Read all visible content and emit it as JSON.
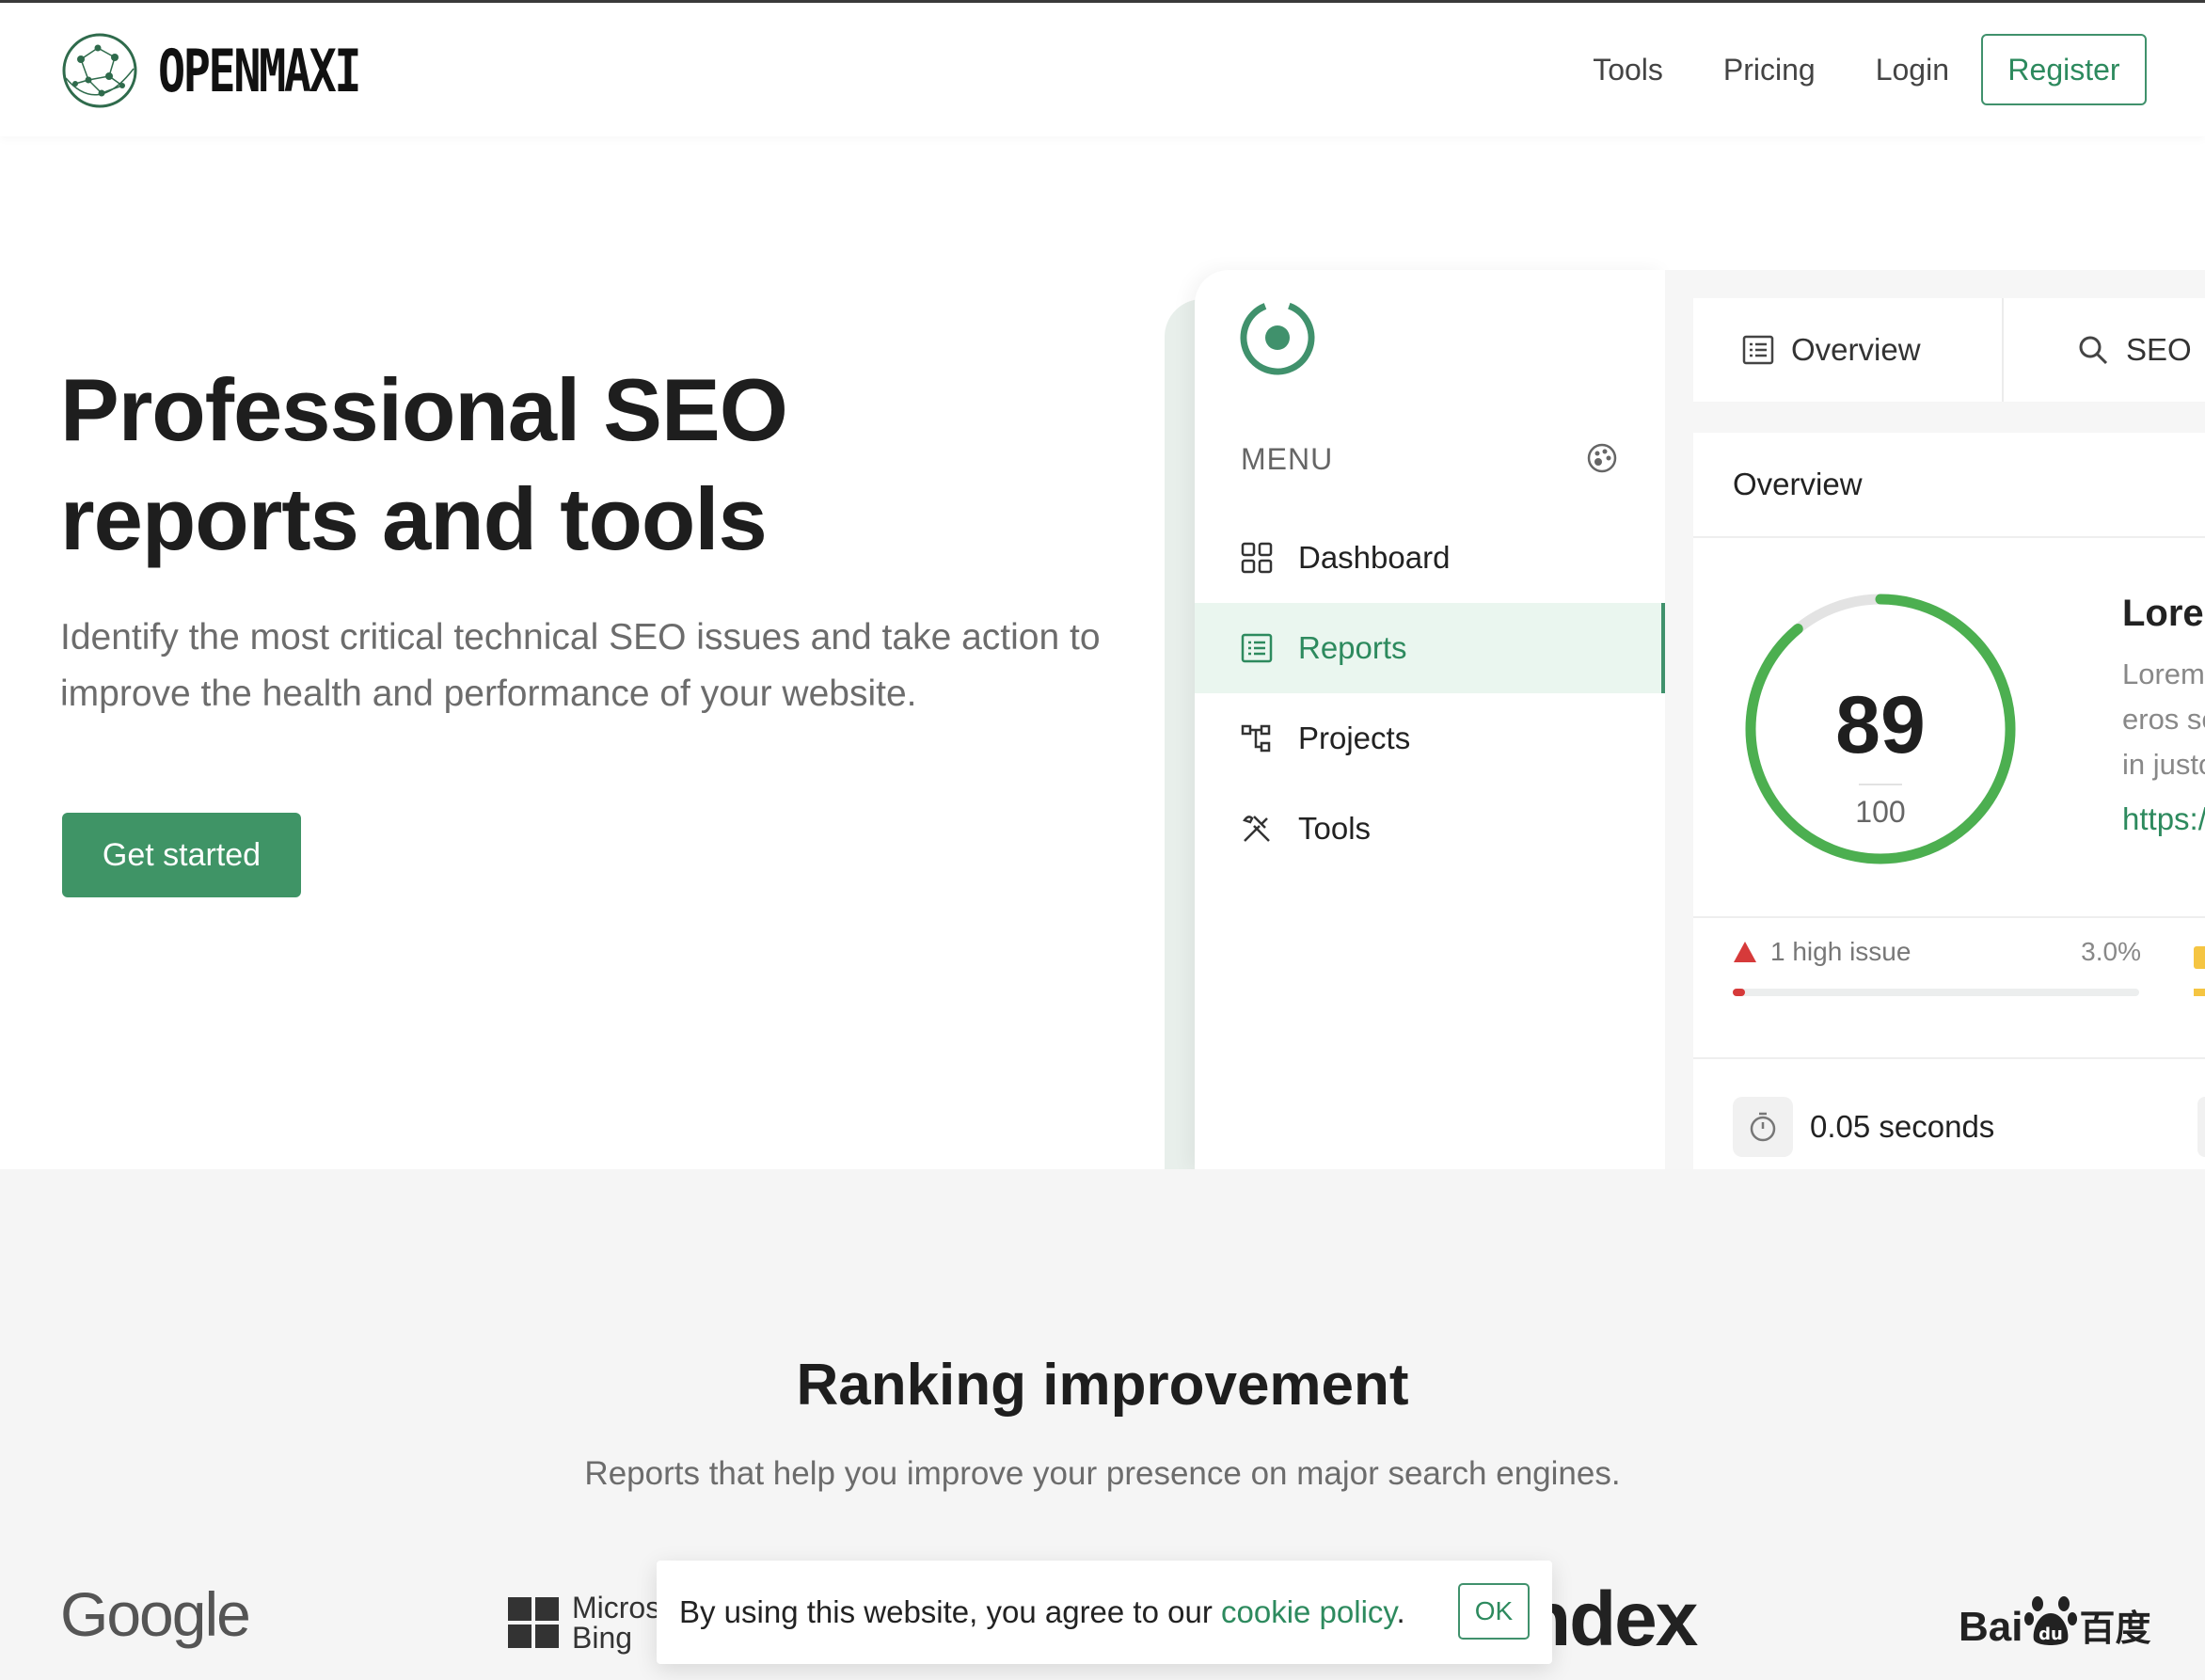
{
  "brand": {
    "name": "OPENMAXI"
  },
  "nav": {
    "tools": "Tools",
    "pricing": "Pricing",
    "login": "Login",
    "register": "Register"
  },
  "hero": {
    "title_line1": "Professional SEO",
    "title_line2": "reports and tools",
    "description": "Identify the most critical technical SEO issues and take action to improve the health and performance of your website.",
    "cta": "Get started"
  },
  "mockup": {
    "menu_title": "MENU",
    "menu_items": [
      {
        "label": "Dashboard",
        "icon": "grid-icon",
        "active": false
      },
      {
        "label": "Reports",
        "icon": "list-icon",
        "active": true
      },
      {
        "label": "Projects",
        "icon": "projects-icon",
        "active": false
      },
      {
        "label": "Tools",
        "icon": "tools-icon",
        "active": false
      }
    ],
    "tabs": [
      {
        "label": "Overview",
        "icon": "list-icon"
      },
      {
        "label": "SEO",
        "icon": "search-icon"
      }
    ],
    "card": {
      "header": "Overview",
      "score": "89",
      "score_max": "100",
      "title": "Lorem",
      "text_lines": [
        "Lorem ip",
        "eros ser",
        "in justo"
      ],
      "link": "https://e",
      "issue_label": "1 high issue",
      "issue_pct": "3.0%",
      "issue_fraction": 0.03,
      "load_time": "0.05 seconds"
    }
  },
  "ranking": {
    "title": "Ranking improvement",
    "subtitle": "Reports that help you improve your presence on major search engines.",
    "engines": {
      "google": "Google",
      "bing_line1": "Micros",
      "bing_line2": "Bing",
      "yandex": "ndex",
      "baidu_a": "Bai",
      "baidu_b": "百度"
    }
  },
  "cookie": {
    "text_before": "By using this website, you agree to our ",
    "link": "cookie policy",
    "text_after": ".",
    "ok": "OK"
  },
  "colors": {
    "accent": "#40916c",
    "accent_dark": "#2d8a5e",
    "danger": "#d63a3a",
    "warning": "#f5c542"
  }
}
